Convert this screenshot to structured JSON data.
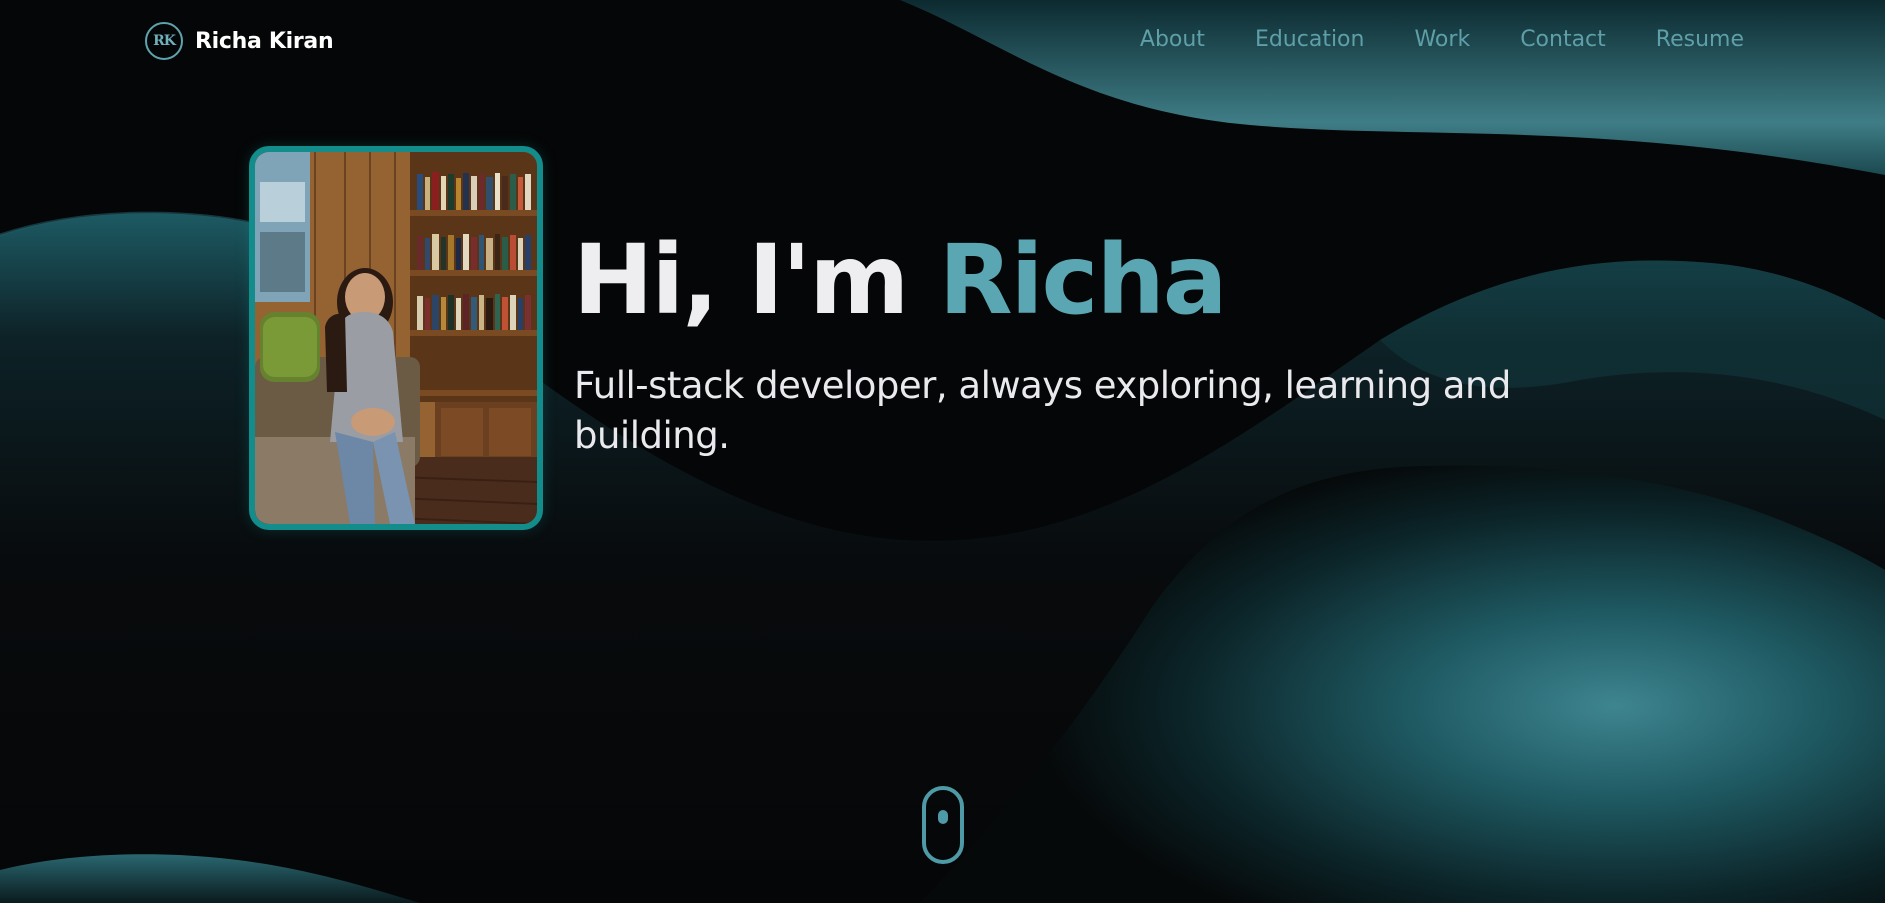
{
  "colors": {
    "background": "#050607",
    "accent": "#5aa7b3",
    "nav": "#5e9fa9",
    "photo_border": "#138c8c",
    "wave": "#2c6f79"
  },
  "header": {
    "logo_initials": "RK",
    "logo_name": "Richa Kiran",
    "nav": [
      {
        "label": "About"
      },
      {
        "label": "Education"
      },
      {
        "label": "Work"
      },
      {
        "label": "Contact"
      },
      {
        "label": "Resume"
      }
    ]
  },
  "hero": {
    "greeting": "Hi, I'm",
    "name": "Richa",
    "subtitle": "Full-stack developer, always exploring, learning and building."
  },
  "scroll_indicator": {
    "icon": "mouse-scroll-icon"
  }
}
